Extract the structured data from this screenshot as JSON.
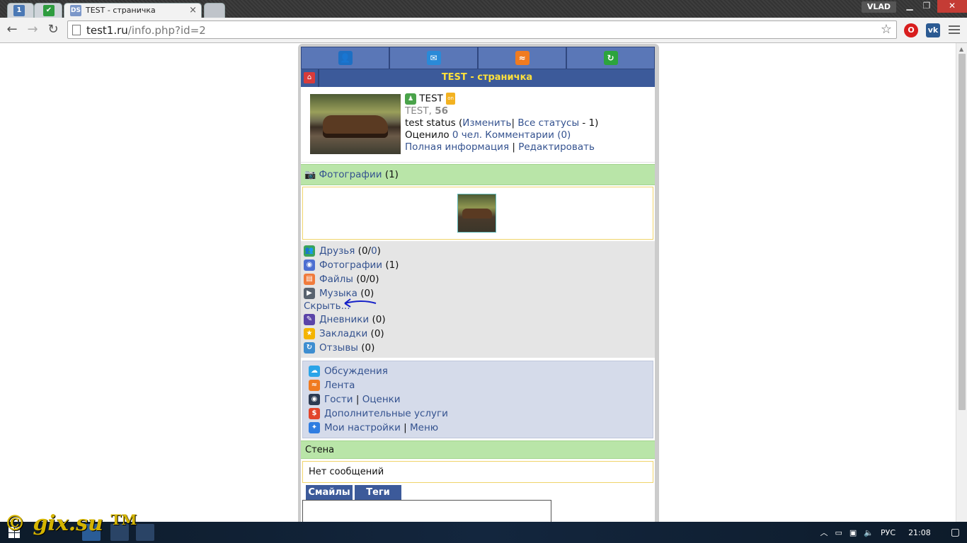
{
  "browser": {
    "tabs": [
      {
        "label": "",
        "favicon": "1"
      },
      {
        "label": "",
        "favicon": "check"
      },
      {
        "label": "TEST - страничка",
        "favicon": "DS"
      }
    ],
    "user_badge": "VLAD",
    "url_host": "test1.ru",
    "url_path": "/info.php?id=2"
  },
  "site": {
    "page_title": "TEST - страничка",
    "profile": {
      "name": "TEST",
      "online_badge": "on",
      "name_line_name": "TEST",
      "name_line_sep": ",",
      "age": "56",
      "status_text": "test status",
      "status_open": "(",
      "status_change": "Изменить",
      "status_sep": "|",
      "all_statuses": "Все статусы",
      "status_count": "- 1)",
      "rated_label": "Оценило",
      "rated_value": "0 чел.",
      "comments_label": "Комментарии",
      "comments_value": "(0)",
      "full_info": "Полная информация",
      "link_sep": "|",
      "edit": "Редактировать"
    },
    "photos_header": {
      "label": "Фотографии",
      "count": "(1)"
    },
    "sections": [
      {
        "label": "Друзья",
        "count_prefix": "(0/",
        "count_link": "0",
        "count_suffix": ")",
        "color": "#3aa35b",
        "glyph": "👥"
      },
      {
        "label": "Фотографии",
        "count": "(1)",
        "color": "#4d6fd1",
        "glyph": "◉"
      },
      {
        "label": "Файлы",
        "count": "(0/0)",
        "color": "#f07b3c",
        "glyph": "▤"
      },
      {
        "label": "Музыка",
        "count": "(0)",
        "color": "#59636f",
        "glyph": "▶"
      }
    ],
    "hide_link": "Скрыть...",
    "sections2": [
      {
        "label": "Дневники",
        "count": "(0)",
        "color": "#5b44a8",
        "glyph": "✎"
      },
      {
        "label": "Закладки",
        "count": "(0)",
        "color": "#f4b400",
        "glyph": "★"
      },
      {
        "label": "Отзывы",
        "count": "(0)",
        "color": "#3e8ed0",
        "glyph": "↻"
      }
    ],
    "menu": [
      {
        "label": "Обсуждения",
        "color": "#2aa4e8",
        "glyph": "☁"
      },
      {
        "label": "Лента",
        "color": "#f07b20",
        "glyph": "≈"
      },
      {
        "label": "Гости",
        "extra": "Оценки",
        "color": "#2b3a52",
        "glyph": "👁"
      },
      {
        "label": "Дополнительные услуги",
        "color": "#e2452b",
        "glyph": "$"
      },
      {
        "label": "Мои настройки",
        "extra": "Меню",
        "color": "#2f7de1",
        "glyph": "🔧"
      }
    ],
    "wall": {
      "title": "Стена",
      "empty": "Нет сообщений"
    },
    "post_tabs": [
      "Смайлы",
      "Теги"
    ]
  },
  "taskbar": {
    "watermark": "gix.su",
    "watermark_tm": "TM",
    "lang": "РУС",
    "time": "21:08"
  },
  "colors": {
    "site_blue": "#3c5a9a",
    "title_yellow": "#ffe13b",
    "green_bar": "#b9e5a8",
    "menu_box": "#d5dbea"
  }
}
